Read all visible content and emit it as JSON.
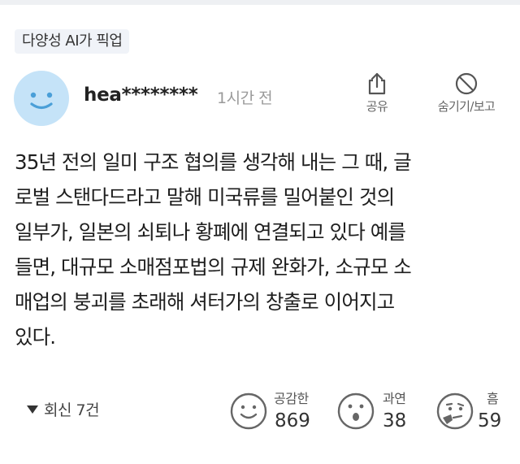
{
  "tag": "다양성 AI가 픽업",
  "comment": {
    "author": "hea********",
    "time": "1시간 전",
    "lines": [
      "35년 전의 일미 구조 협의를 생각해 내는 그 때, 글",
      "로벌 스탠다드라고 말해 미국류를 밀어붙인 것의",
      "일부가, 일본의 쇠퇴나 황폐에 연결되고 있다 예를",
      "들면, 대규모 소매점포법의 규제 완화가, 소규모 소",
      "매업의 붕괴를 초래해 셔터가의 창출로 이어지고",
      "있다."
    ]
  },
  "actions": {
    "share": {
      "label": "공유",
      "icon": "share-icon"
    },
    "hide": {
      "label": "숨기기/보고",
      "icon": "block-icon"
    }
  },
  "replies": {
    "label": "회신 7건"
  },
  "reactions": [
    {
      "label": "공감한",
      "count": "869",
      "icon": "smile-face-icon"
    },
    {
      "label": "과연",
      "count": "38",
      "icon": "surprised-face-icon"
    },
    {
      "label": "흠",
      "count": "59",
      "icon": "thinking-face-icon"
    }
  ],
  "colors": {
    "tag_bg": "#f0f3f8",
    "avatar_bg": "#c5e3f8",
    "avatar_face": "#4a9fd8",
    "muted_text": "#9a9a9a"
  }
}
